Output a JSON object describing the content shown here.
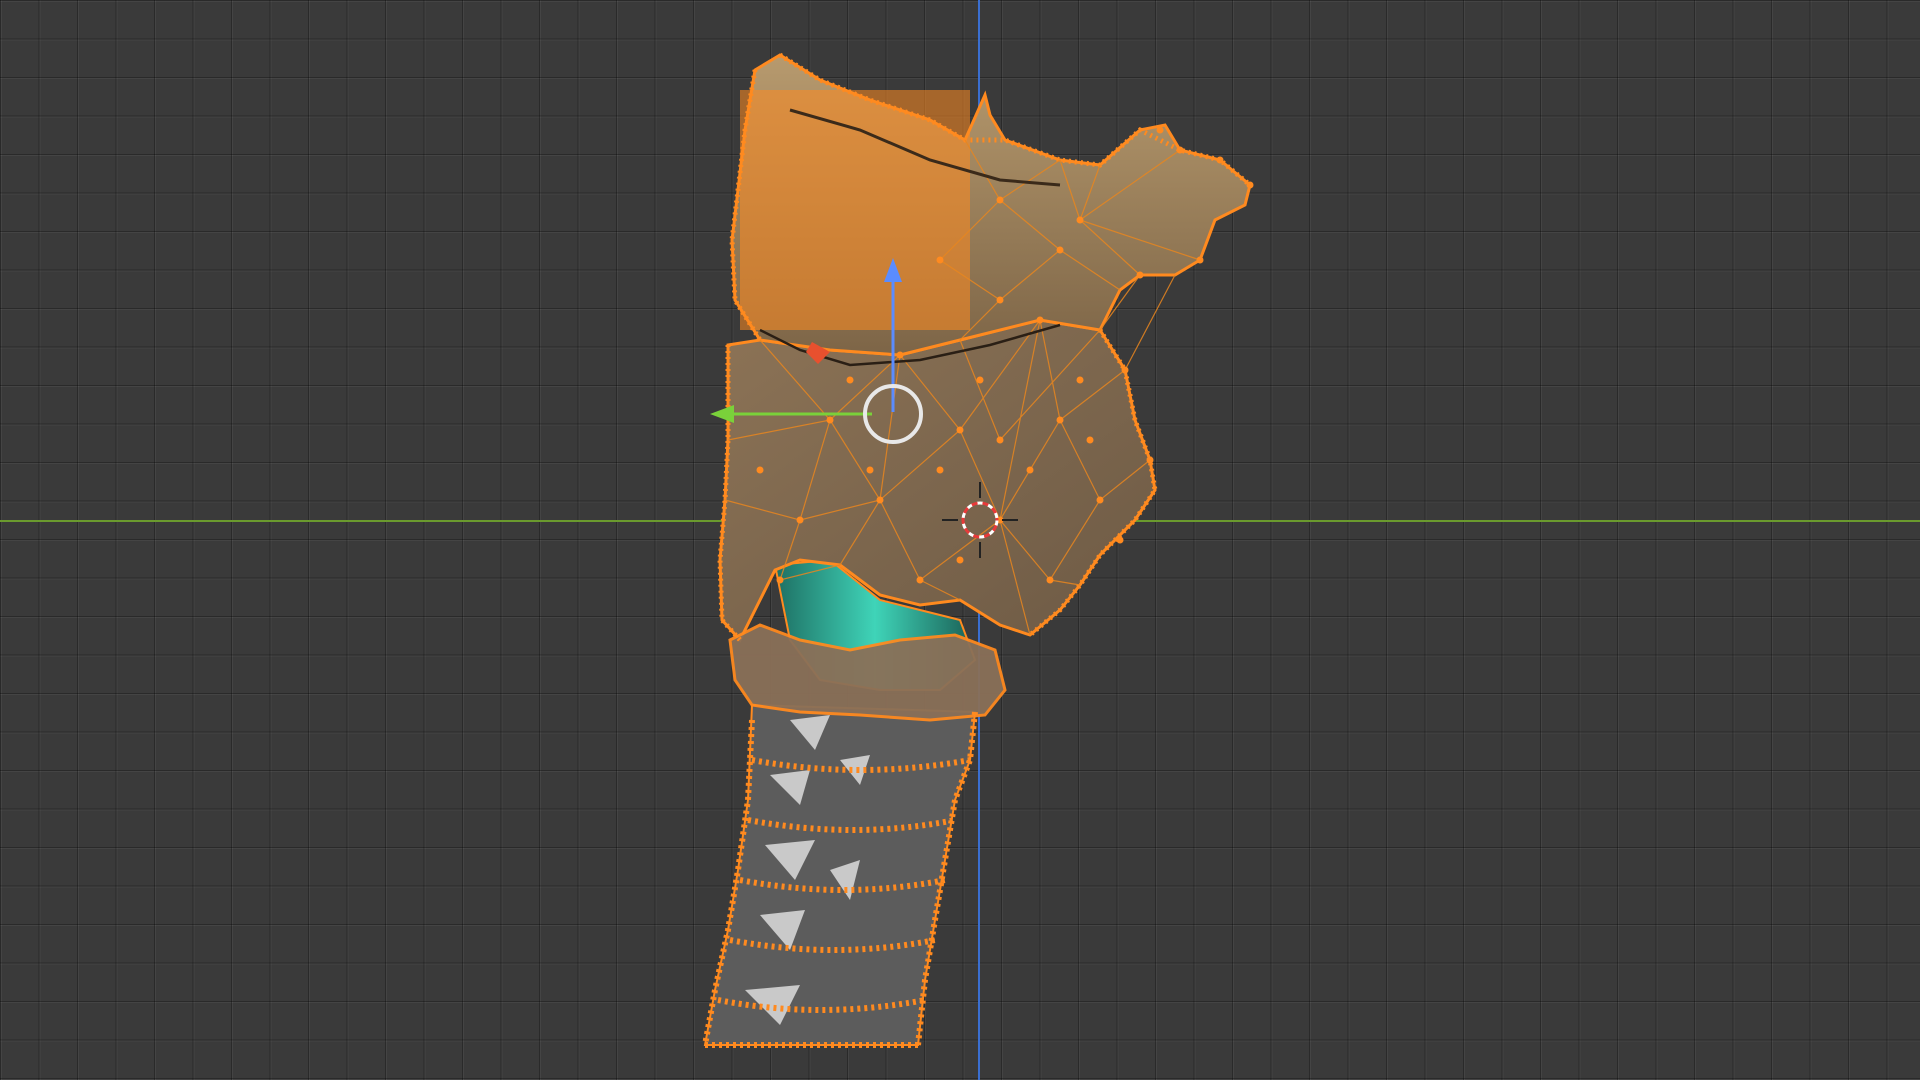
{
  "viewport": {
    "mode": "edit-mode-vertex-select",
    "grid_visible": true
  },
  "colors": {
    "background": "#3a3a3a",
    "grid_line": "#2e2e2e",
    "x_axis": "#6a9a2e",
    "y_axis": "#3a6fd1",
    "selection": "#ff8a1f",
    "mesh_fill": "#9a7a55",
    "mesh_teal": "#2fb8a0",
    "mesh_light": "#d8d8d8",
    "gizmo_z": "#5a8cff",
    "gizmo_y": "#7ad13a",
    "gizmo_x": "#e8502e",
    "gizmo_center": "#e8e8e8"
  },
  "objects": {
    "larynx_mesh": {
      "selected": true
    },
    "transform_gizmo": {
      "axes": [
        "x-axis-handle",
        "y-axis-handle",
        "z-axis-handle"
      ]
    },
    "cursor_3d": {
      "icon": "crosshair-icon"
    }
  }
}
